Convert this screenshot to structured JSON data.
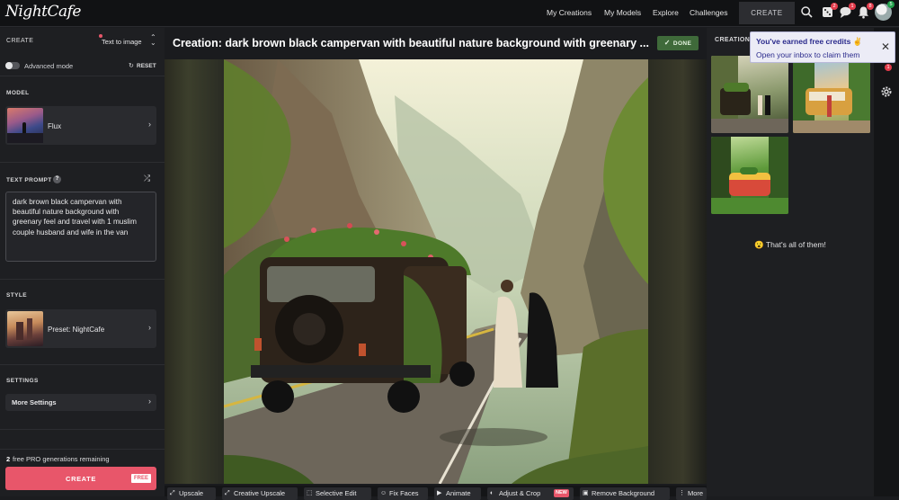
{
  "app": {
    "logo": "NightCafe"
  },
  "nav": {
    "my_creations": "My Creations",
    "my_models": "My Models",
    "explore": "Explore",
    "challenges": "Challenges",
    "create": "CREATE",
    "badges": {
      "dice": "2",
      "chat": "1",
      "bell": "8",
      "avatar": "5"
    }
  },
  "left": {
    "create_label": "CREATE",
    "mode": "Text to image",
    "advanced_mode": "Advanced mode",
    "reset": "RESET",
    "model_label": "MODEL",
    "model_name": "Flux",
    "prompt_label": "TEXT PROMPT",
    "prompt_help": "?",
    "prompt_text": "dark brown black campervan with beautiful nature background with greenary feel and travel with 1 muslim couple husband and wife in the van",
    "style_label": "STYLE",
    "style_name": "Preset: NightCafe",
    "settings_label": "SETTINGS",
    "more_settings": "More Settings",
    "remaining_count": "2",
    "remaining_text": "free PRO generations remaining",
    "create_button": "CREATE",
    "free_tag": "FREE"
  },
  "center": {
    "title": "Creation: dark brown black campervan with beautiful nature background with greenary ...",
    "done": "DONE",
    "toolbar": [
      "Upscale",
      "Creative Upscale",
      "Selective Edit",
      "Fix Faces",
      "Animate",
      "Adjust & Crop",
      "Remove Background",
      "More"
    ],
    "new_badge": "NEW"
  },
  "right": {
    "header": "CREATION",
    "end_text": "That's all of them!",
    "end_emoji": "😮"
  },
  "notification": {
    "title": "You've earned free credits",
    "title_emoji": "✌",
    "body": "Open your inbox to claim them",
    "rail_badge": "1"
  },
  "colors": {
    "accent": "#e8566a",
    "done_green": "#3f6a3a",
    "notif_title": "#2a2a8c"
  }
}
